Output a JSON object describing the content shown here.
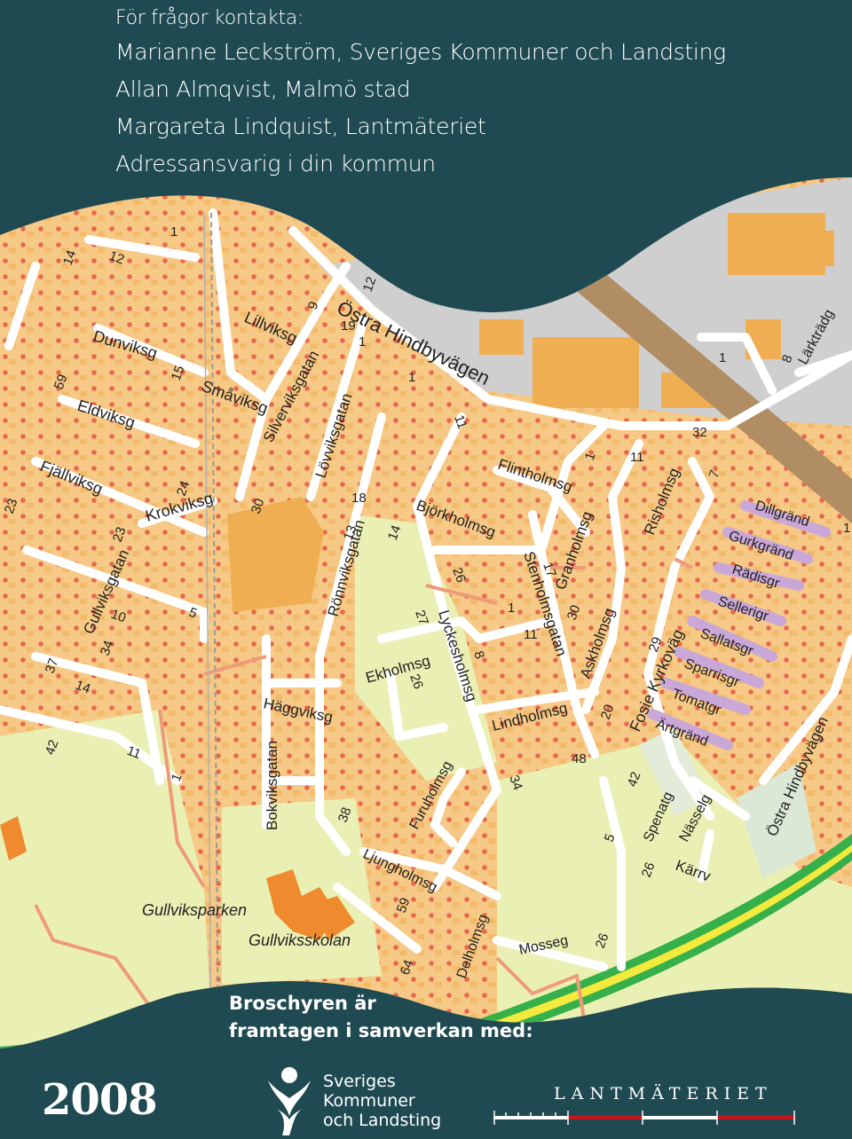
{
  "header": {
    "contact_heading": "För frågor kontakta:",
    "contacts": [
      "Marianne Leckström, Sveriges Kommuner och Landsting",
      "Allan Almqvist, Malmö stad",
      "Margareta Lindquist, Lantmäteriet",
      "Adressansvarig i din kommun"
    ]
  },
  "map": {
    "colors": {
      "block": "#f6c987",
      "park": "#eaf0b4",
      "road": "#ffffff",
      "building": "#f0ae53",
      "address_dot": "#e01818",
      "rail": "#b08d63",
      "highway_yellow": "#f3ea3d",
      "highway_green": "#36b04a",
      "school": "#ef8a2e",
      "lilac_street": "#c9a7d6",
      "dark": "#1f4a52"
    },
    "street_labels": [
      "Östra Hindbyvägen",
      "Dunviksg",
      "Eldviksg",
      "Fjällviksg",
      "Småviksg",
      "Lillviksg",
      "Silverviksgatan",
      "Lövviksgatan",
      "Krokviksg",
      "Gullviksgatan",
      "Rönnviksgatan",
      "Häggviksg",
      "Bokviksgatan",
      "Björkholmsg",
      "Flintholmsg",
      "Granholmsg",
      "Stenholmsgatan",
      "Lyckesholmsg",
      "Ekholmsg",
      "Lindholmsg",
      "Askholmsg",
      "Risholmsg",
      "Dillgränd",
      "Gurkgränd",
      "Rädisgr",
      "Sellerigr",
      "Sallatsgr",
      "Sparrisgr",
      "Tomatgr",
      "Ärtgränd",
      "Fosie Kyrkoväg",
      "Spenatg",
      "Nässelg",
      "Kärrv",
      "Östra Hindbyvägen",
      "Furuholmsg",
      "Ljungholmsg",
      "Delholmsg",
      "Mosseg",
      "Lärkträdg"
    ],
    "place_labels": [
      "Gullviksparken",
      "Gullviksskolan"
    ],
    "house_numbers": [
      "1",
      "12",
      "14",
      "12",
      "9",
      "19",
      "1",
      "1",
      "11",
      "59",
      "15",
      "23",
      "24",
      "30",
      "18",
      "13",
      "14",
      "23",
      "10",
      "5",
      "34",
      "37",
      "14",
      "42",
      "11",
      "1",
      "38",
      "27",
      "26",
      "26",
      "8",
      "1",
      "11",
      "30",
      "17",
      "1",
      "11",
      "7",
      "29",
      "20",
      "48",
      "42",
      "34",
      "5",
      "26",
      "59",
      "64",
      "26",
      "32",
      "1",
      "8",
      "1"
    ]
  },
  "footer": {
    "collaboration_line1": "Broschyren är",
    "collaboration_line2": "framtagen i samverkan med:",
    "year": "2008",
    "skl_line1": "Sveriges",
    "skl_line2": "Kommuner",
    "skl_line3": "och Landsting",
    "lantmateriet": "LANTMÄTERIET",
    "icons": [
      "skl-logo-icon",
      "lantmateriet-scale-icon"
    ]
  }
}
